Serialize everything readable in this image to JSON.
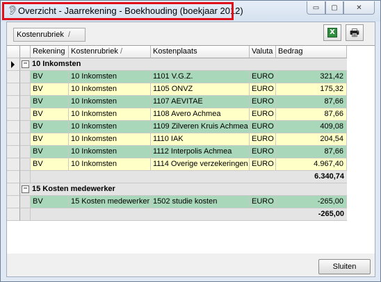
{
  "window": {
    "title": "Overzicht - Jaarrekening - Boekhouding (boekjaar 2012)",
    "icon": "ear-icon",
    "controls": {
      "minimize": "▭",
      "maximize": "▢",
      "close": "✕"
    }
  },
  "toolbar": {
    "group_by_label": "Kostenrubriek",
    "group_by_sort": "/",
    "excel_icon": "excel-export-icon",
    "excel_glyph": "X",
    "print_icon": "printer-icon",
    "print_glyph": "🖶"
  },
  "grid": {
    "columns": [
      {
        "label": "Rekening"
      },
      {
        "label": "Kostenrubriek",
        "sort": "/"
      },
      {
        "label": "Kostenplaats"
      },
      {
        "label": "Valuta"
      },
      {
        "label": "Bedrag"
      }
    ],
    "groups": [
      {
        "label": "10 Inkomsten",
        "expander": "−",
        "rows": [
          {
            "rekening": "BV",
            "kostenrubriek": "10 Inkomsten",
            "kostenplaats": "1101 V.G.Z.",
            "valuta": "EURO",
            "bedrag": "321,42",
            "color": "green"
          },
          {
            "rekening": "BV",
            "kostenrubriek": "10 Inkomsten",
            "kostenplaats": "1105 ONVZ",
            "valuta": "EURO",
            "bedrag": "175,32",
            "color": "yellow"
          },
          {
            "rekening": "BV",
            "kostenrubriek": "10 Inkomsten",
            "kostenplaats": "1107 AEVITAE",
            "valuta": "EURO",
            "bedrag": "87,66",
            "color": "green"
          },
          {
            "rekening": "BV",
            "kostenrubriek": "10 Inkomsten",
            "kostenplaats": "1108 Avero Achmea",
            "valuta": "EURO",
            "bedrag": "87,66",
            "color": "yellow"
          },
          {
            "rekening": "BV",
            "kostenrubriek": "10 Inkomsten",
            "kostenplaats": "1109 Zilveren Kruis Achmea",
            "valuta": "EURO",
            "bedrag": "409,08",
            "color": "green"
          },
          {
            "rekening": "BV",
            "kostenrubriek": "10 Inkomsten",
            "kostenplaats": "1110 IAK",
            "valuta": "EURO",
            "bedrag": "204,54",
            "color": "yellow"
          },
          {
            "rekening": "BV",
            "kostenrubriek": "10 Inkomsten",
            "kostenplaats": "1112 Interpolis Achmea",
            "valuta": "EURO",
            "bedrag": "87,66",
            "color": "green"
          },
          {
            "rekening": "BV",
            "kostenrubriek": "10 Inkomsten",
            "kostenplaats": "1114 Overige verzekeringen",
            "valuta": "EURO",
            "bedrag": "4.967,40",
            "color": "yellow"
          }
        ],
        "total": "6.340,74"
      },
      {
        "label": "15 Kosten medewerker",
        "expander": "−",
        "rows": [
          {
            "rekening": "BV",
            "kostenrubriek": "15 Kosten medewerker",
            "kostenplaats": "1502 studie kosten",
            "valuta": "EURO",
            "bedrag": "-265,00",
            "color": "green"
          }
        ],
        "total": "-265,00"
      }
    ]
  },
  "footer": {
    "close_label": "Sluiten"
  }
}
